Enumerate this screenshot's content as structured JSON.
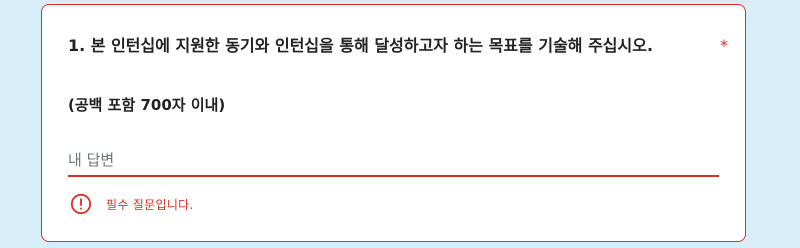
{
  "question": {
    "title": "1. 본 인턴십에 지원한 동기와 인턴십을 통해 달성하고자 하는 목표를 기술해 주십시오.",
    "required_mark": "*",
    "subtitle": "(공백 포함 700자 이내)"
  },
  "answer": {
    "placeholder": "내 답변",
    "value": ""
  },
  "error": {
    "icon": "error-circle-icon",
    "message": "필수 질문입니다."
  },
  "colors": {
    "background": "#d7eef8",
    "card": "#ffffff",
    "error": "#d93025",
    "text": "#202124",
    "placeholder": "#70757a"
  }
}
